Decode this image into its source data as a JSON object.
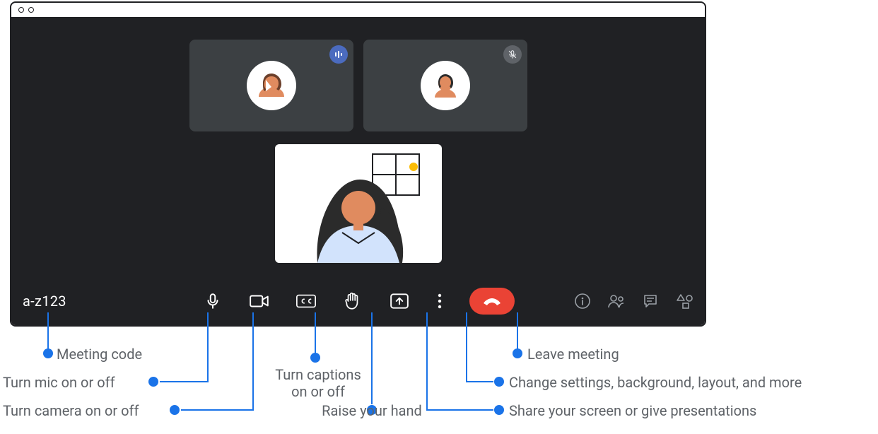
{
  "meeting": {
    "code": "a-z123"
  },
  "participants": {
    "tile1_status": "speaking",
    "tile2_status": "muted"
  },
  "annotations": {
    "meeting_code": "Meeting code",
    "mic": "Turn mic on or off",
    "camera": "Turn camera on or off",
    "captions_line1": "Turn captions",
    "captions_line2": "on or off",
    "raise_hand": "Raise your hand",
    "present": "Share your screen or give presentations",
    "more": "Change settings, background, layout, and more",
    "leave": "Leave meeting"
  }
}
